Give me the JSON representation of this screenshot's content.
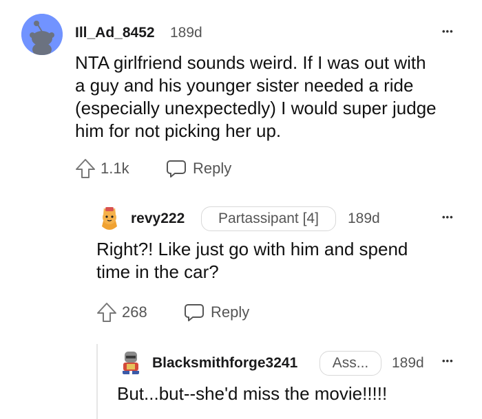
{
  "comments": [
    {
      "username": "Ill_Ad_8452",
      "age": "189d",
      "more": "•••",
      "body_lines": [
        "NTA girlfriend sounds weird. If I was out with",
        "a guy and his younger sister needed a ride",
        "(especially unexpectedly) I would super judge",
        "him for not picking her up."
      ],
      "votes": "1.1k",
      "reply_label": "Reply"
    },
    {
      "username": "revy222",
      "flair": "Partassipant [4]",
      "age": "189d",
      "more": "•••",
      "body_lines": [
        "Right?! Like just go with him and spend",
        "time in the car?"
      ],
      "votes": "268",
      "reply_label": "Reply"
    },
    {
      "username": "Blacksmithforge3241",
      "flair": "Ass...",
      "age": "189d",
      "more": "•••",
      "body_lines": [
        "But...but--she'd miss the movie!!!!!"
      ]
    }
  ],
  "colors": {
    "avatar_bg": "#7193ff",
    "text": "#1a1a1b",
    "muted": "#555555",
    "thread_line": "#e6e6e6"
  },
  "icons": {
    "upvote": "upvote-arrow-icon",
    "reply": "speech-bubble-icon",
    "more": "more-dots-icon"
  }
}
